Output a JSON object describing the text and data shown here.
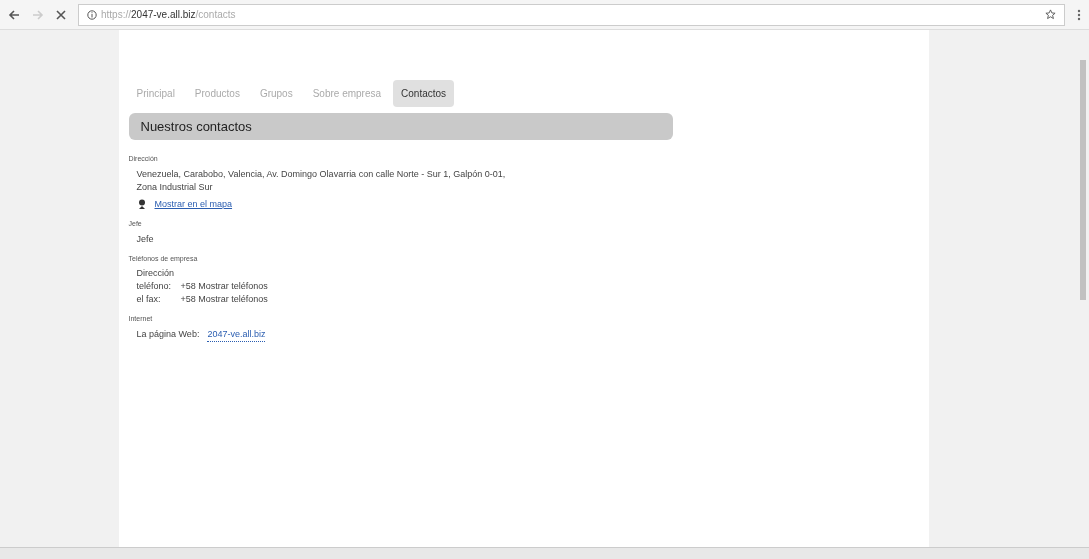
{
  "browser": {
    "url_prefix": "https://",
    "url_host": "2047-ve.all.biz",
    "url_path": "/contacts"
  },
  "tabs": [
    {
      "label": "Principal",
      "selected": false
    },
    {
      "label": "Productos",
      "selected": false
    },
    {
      "label": "Grupos",
      "selected": false
    },
    {
      "label": "Sobre empresa",
      "selected": false
    },
    {
      "label": "Contactos",
      "selected": true
    }
  ],
  "heading": "Nuestros contactos",
  "sections": [
    {
      "title": "Dirección",
      "lines": [
        {
          "kind": "text",
          "text": "Venezuela, Carabobo, Valencia, Av. Domingo Olavarria con calle Norte - Sur 1, Galpón 0-01, Zona Industrial Sur"
        },
        {
          "kind": "map_link",
          "text": "Mostrar en el mapa"
        }
      ]
    },
    {
      "title": "Jefe",
      "lines": [
        {
          "kind": "text",
          "text": "Jefe"
        }
      ]
    },
    {
      "title": "Teléfonos de empresa",
      "lines": [
        {
          "kind": "text",
          "text": "Dirección"
        },
        {
          "kind": "phone",
          "label": "teléfono:",
          "text": "+58 Mostrar teléfonos"
        },
        {
          "kind": "phone",
          "label": "el fax:",
          "text": "+58 Mostrar teléfonos"
        }
      ]
    },
    {
      "title": "Internet",
      "lines": [
        {
          "kind": "web",
          "label": "La página Web:",
          "text": "2047-ve.all.biz"
        }
      ]
    }
  ]
}
